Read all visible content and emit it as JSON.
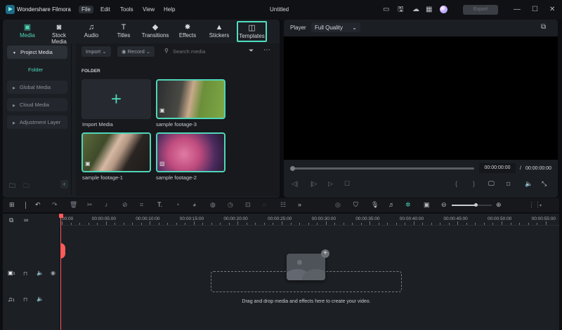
{
  "app": {
    "name": "Wondershare Filmora",
    "window_title": "Untitled",
    "export_label": "Export",
    "menu": [
      "File",
      "Edit",
      "Tools",
      "View",
      "Help"
    ],
    "active_menu": "File"
  },
  "tabs": [
    {
      "label": "Media",
      "icon": "media-icon",
      "active": true
    },
    {
      "label": "Stock Media",
      "icon": "stock-media-icon"
    },
    {
      "label": "Audio",
      "icon": "music-note-icon"
    },
    {
      "label": "Titles",
      "icon": "text-icon"
    },
    {
      "label": "Transitions",
      "icon": "transitions-icon"
    },
    {
      "label": "Effects",
      "icon": "effects-icon"
    },
    {
      "label": "Stickers",
      "icon": "stickers-icon"
    },
    {
      "label": "Templates",
      "icon": "templates-icon",
      "highlighted": true
    }
  ],
  "sidebar": {
    "project_media": "Project Media",
    "folder": "Folder",
    "items": [
      "Global Media",
      "Cloud Media",
      "Adjustment Layer"
    ]
  },
  "media": {
    "import": "Import",
    "record": "Record",
    "search_placeholder": "Search media",
    "section": "FOLDER",
    "import_media": "Import Media",
    "items": [
      "sample footage-3",
      "sample footage-1",
      "sample footage-2"
    ]
  },
  "player": {
    "label": "Player",
    "quality": "Full Quality",
    "current_time": "00:00:00:00",
    "total_time": "00:00:00:00",
    "separator": "/",
    "progress": 0
  },
  "timeline": {
    "ruler": [
      "00:00",
      "00:00:05:00",
      "00:00:10:00",
      "00:00:15:00",
      "00:00:20:00",
      "00:00:25:00",
      "00:00:30:00",
      "00:00:35:00",
      "00:00:40:00",
      "00:00:45:00",
      "00:00:50:00",
      "00:00:55:00"
    ],
    "video_track": "1",
    "audio_track": "1",
    "drop_text": "Drag and drop media and effects here to create your video.",
    "zoom_level": 0.6
  },
  "colors": {
    "accent": "#4fd6b8",
    "playhead": "#ff5a5a"
  }
}
